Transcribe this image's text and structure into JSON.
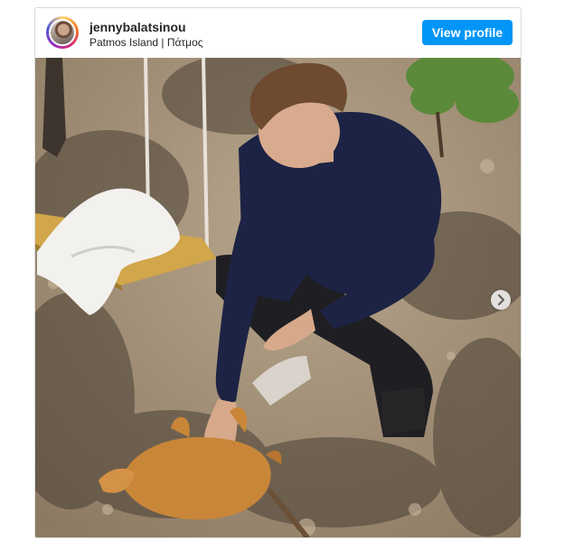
{
  "post": {
    "username": "jennybalatsinou",
    "location": "Patmos Island | Πάτμος",
    "view_profile_label": "View profile"
  },
  "icons": {
    "next": "chevron-right-icon"
  },
  "colors": {
    "button": "#0095f6",
    "text": "#262626",
    "border": "#dbdbdb"
  }
}
